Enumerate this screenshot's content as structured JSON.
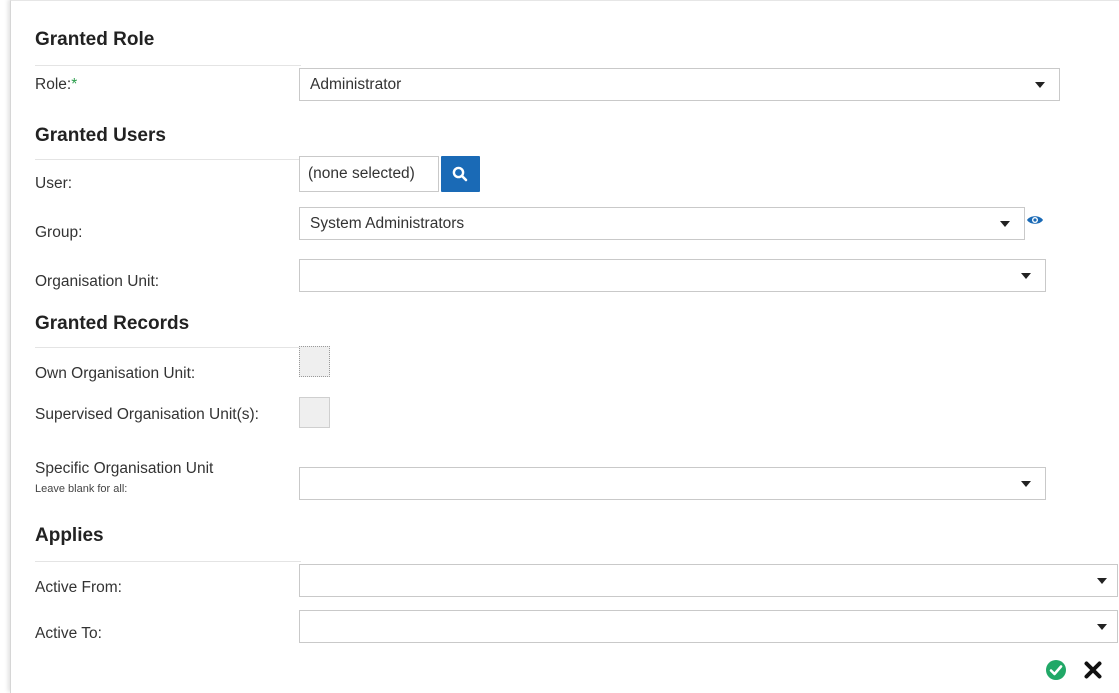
{
  "sections": {
    "granted_role": "Granted Role",
    "granted_users": "Granted Users",
    "granted_records": "Granted Records",
    "applies": "Applies"
  },
  "role": {
    "label": "Role:",
    "required_mark": "*",
    "value": "Administrator"
  },
  "user": {
    "label": "User:",
    "value": "(none selected)",
    "icon": "search-icon"
  },
  "group": {
    "label": "Group:",
    "value": "System Administrators",
    "icon": "eye-icon"
  },
  "org_unit": {
    "label": "Organisation Unit:",
    "value": ""
  },
  "own_org_unit": {
    "label": "Own Organisation Unit:",
    "checked": false
  },
  "supervised_org_unit": {
    "label": "Supervised Organisation Unit(s):",
    "checked": false
  },
  "specific_org_unit": {
    "label": "Specific Organisation Unit",
    "hint": "Leave blank for all",
    "hint_suffix": ":",
    "value": ""
  },
  "active_from": {
    "label": "Active From:",
    "value": ""
  },
  "active_to": {
    "label": "Active To:",
    "value": ""
  },
  "actions": {
    "ok_icon": "check-circle-icon",
    "cancel_icon": "close-icon"
  },
  "colors": {
    "accent_blue": "#1a6ab6",
    "ok_green": "#21a867",
    "required_green": "#2a9d4b"
  }
}
